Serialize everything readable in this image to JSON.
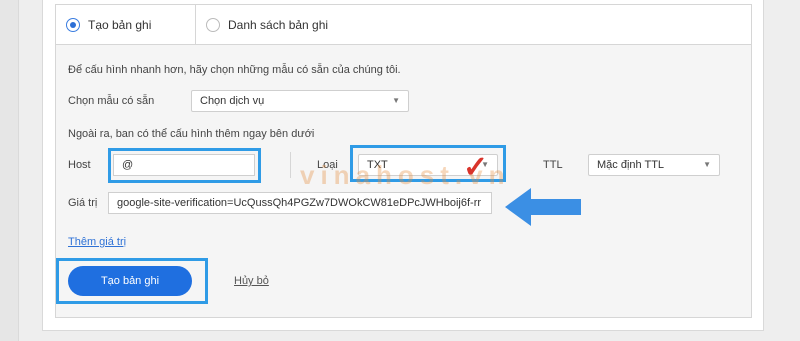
{
  "tabs": {
    "create_label": "Tạo bản ghi",
    "list_label": "Danh sách bản ghi"
  },
  "form": {
    "intro_text": "Để cấu hình nhanh hơn, hãy chọn những mẫu có sẵn của chúng tôi.",
    "template_label": "Chọn mẫu có sẵn",
    "template_value": "Chọn dịch vụ",
    "extra_text": "Ngoài ra, ban có thể cấu hình thêm ngay bên dưới",
    "host_label": "Host",
    "host_value": "@",
    "type_label": "Loại",
    "type_value": "TXT",
    "ttl_label": "TTL",
    "ttl_value": "Mặc định TTL",
    "value_label": "Giá trị",
    "value_value": "google-site-verification=UcQussQh4PGZw7DWOkCW81eDPcJWHboij6f-rr",
    "add_value_link": "Thêm giá trị"
  },
  "actions": {
    "create_button": "Tạo bản ghi",
    "cancel_link": "Hủy bỏ"
  },
  "watermark": "vinahost.vn",
  "colors": {
    "accent": "#1f6fe0",
    "highlight": "#2f9be6",
    "arrow": "#3b8fe4",
    "check": "#d9342b"
  }
}
